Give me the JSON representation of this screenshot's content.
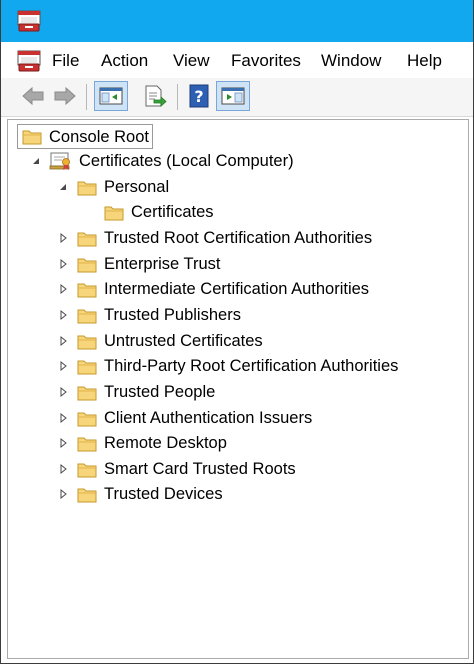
{
  "menubar": {
    "items": [
      {
        "label": "File"
      },
      {
        "label": "Action"
      },
      {
        "label": "View"
      },
      {
        "label": "Favorites"
      },
      {
        "label": "Window"
      },
      {
        "label": "Help"
      }
    ]
  },
  "toolbar": {
    "buttons": [
      "back-arrow-icon",
      "forward-arrow-icon",
      "show-hide-console-tree-icon",
      "export-list-icon",
      "help-icon",
      "show-hide-action-pane-icon"
    ]
  },
  "tree": {
    "root_label": "Console Root",
    "computer_label": "Certificates (Local Computer)",
    "personal": {
      "label": "Personal",
      "child_label": "Certificates"
    },
    "stores": [
      {
        "label": "Trusted Root Certification Authorities"
      },
      {
        "label": "Enterprise Trust"
      },
      {
        "label": "Intermediate Certification Authorities"
      },
      {
        "label": "Trusted Publishers"
      },
      {
        "label": "Untrusted Certificates"
      },
      {
        "label": "Third-Party Root Certification Authorities"
      },
      {
        "label": "Trusted People"
      },
      {
        "label": "Client Authentication Issuers"
      },
      {
        "label": "Remote Desktop"
      },
      {
        "label": "Smart Card Trusted Roots"
      },
      {
        "label": "Trusted Devices"
      }
    ]
  },
  "colors": {
    "titlebar": "#12a8ef",
    "folder_fill": "#f7d57a",
    "folder_stroke": "#c69a2a"
  }
}
